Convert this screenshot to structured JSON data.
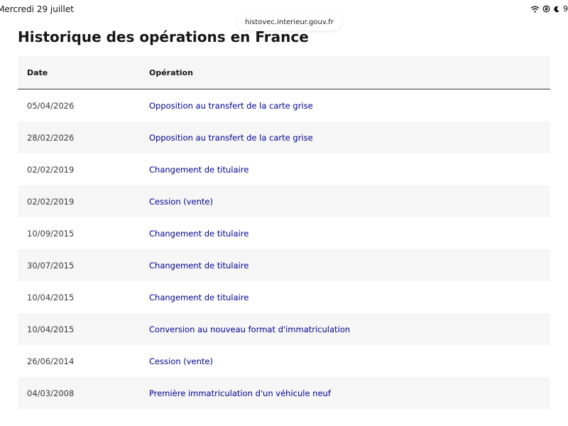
{
  "status_bar": {
    "date": "Mercredi 29 juillet",
    "battery": "9"
  },
  "browser": {
    "url": "histovec.interieur.gouv.fr"
  },
  "page": {
    "title": "Historique des opérations en France"
  },
  "table": {
    "headers": {
      "date": "Date",
      "operation": "Opération"
    },
    "rows": [
      {
        "date": "05/04/2026",
        "operation": "Opposition au transfert de la carte grise"
      },
      {
        "date": "28/02/2026",
        "operation": "Opposition au transfert de la carte grise"
      },
      {
        "date": "02/02/2019",
        "operation": "Changement de titulaire"
      },
      {
        "date": "02/02/2019",
        "operation": "Cession (vente)"
      },
      {
        "date": "10/09/2015",
        "operation": "Changement de titulaire"
      },
      {
        "date": "30/07/2015",
        "operation": "Changement de titulaire"
      },
      {
        "date": "10/04/2015",
        "operation": "Changement de titulaire"
      },
      {
        "date": "10/04/2015",
        "operation": "Conversion au nouveau format d'immatriculation"
      },
      {
        "date": "26/06/2014",
        "operation": "Cession (vente)"
      },
      {
        "date": "04/03/2008",
        "operation": "Première immatriculation d'un véhicule neuf"
      }
    ]
  },
  "colors": {
    "link": "#000091",
    "zebra": "#f6f6f6",
    "text": "#161616"
  },
  "icons": [
    "wifi-icon",
    "screen-lock-icon",
    "moon-icon"
  ]
}
